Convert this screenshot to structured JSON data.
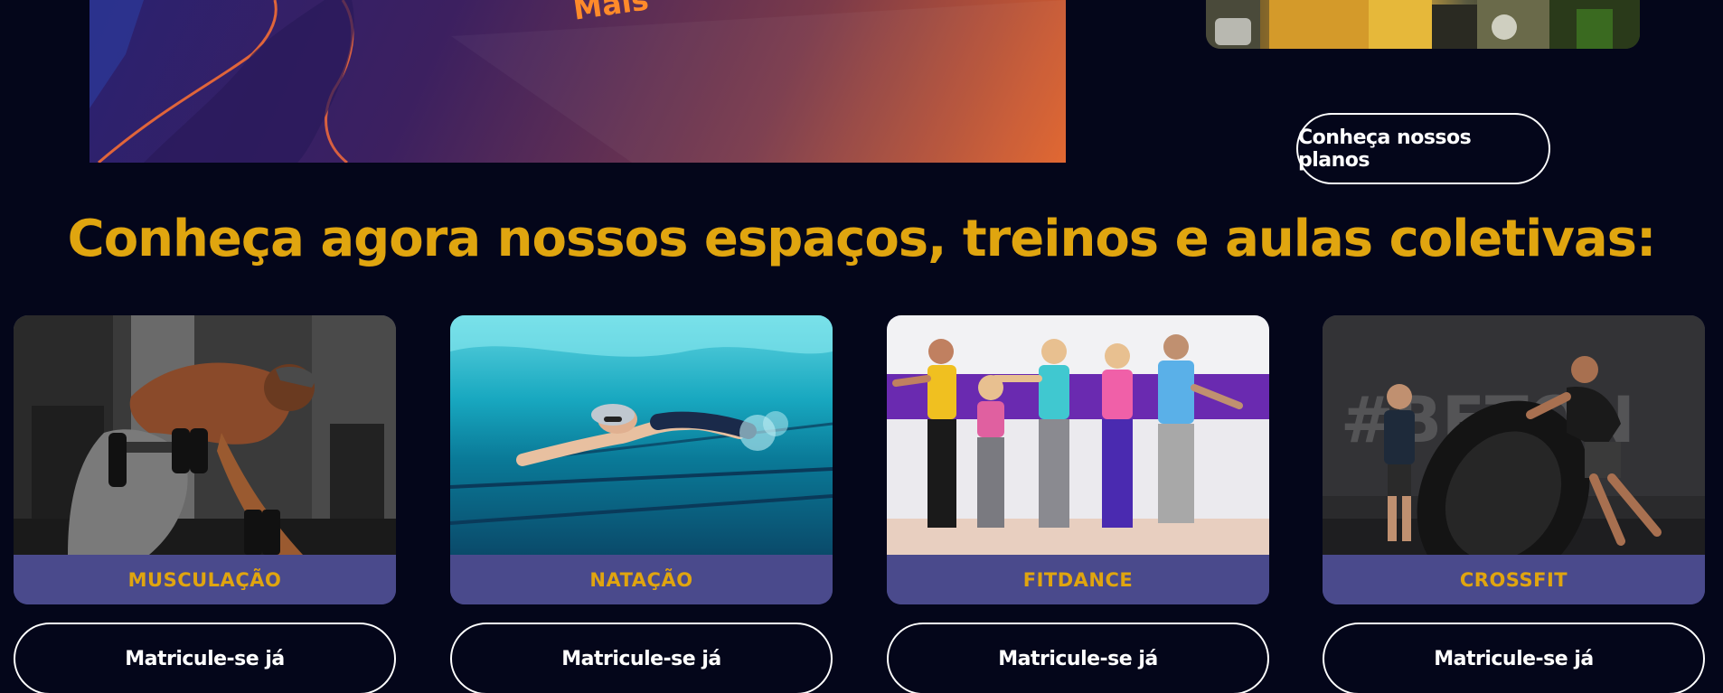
{
  "hero": {
    "banner_text": "Mais"
  },
  "plans_button": {
    "label": "Conheça nossos planos"
  },
  "section": {
    "title": "Conheça agora nossos espaços, treinos e aulas coletivas:"
  },
  "cards": [
    {
      "label": "MUSCULAÇÃO",
      "button": "Matricule-se já",
      "photo": "bodybuilder-dumbbell-photo"
    },
    {
      "label": "NATAÇÃO",
      "button": "Matricule-se já",
      "photo": "swimmer-pool-photo"
    },
    {
      "label": "FITDANCE",
      "button": "Matricule-se já",
      "photo": "dance-group-photo"
    },
    {
      "label": "CROSSFIT",
      "button": "Matricule-se já",
      "photo": "tire-flip-photo"
    }
  ],
  "colors": {
    "background": "#04061a",
    "accent_gold": "#e0a50f",
    "card_label_bg": "#4a4a8c",
    "button_border": "#ffffff"
  }
}
